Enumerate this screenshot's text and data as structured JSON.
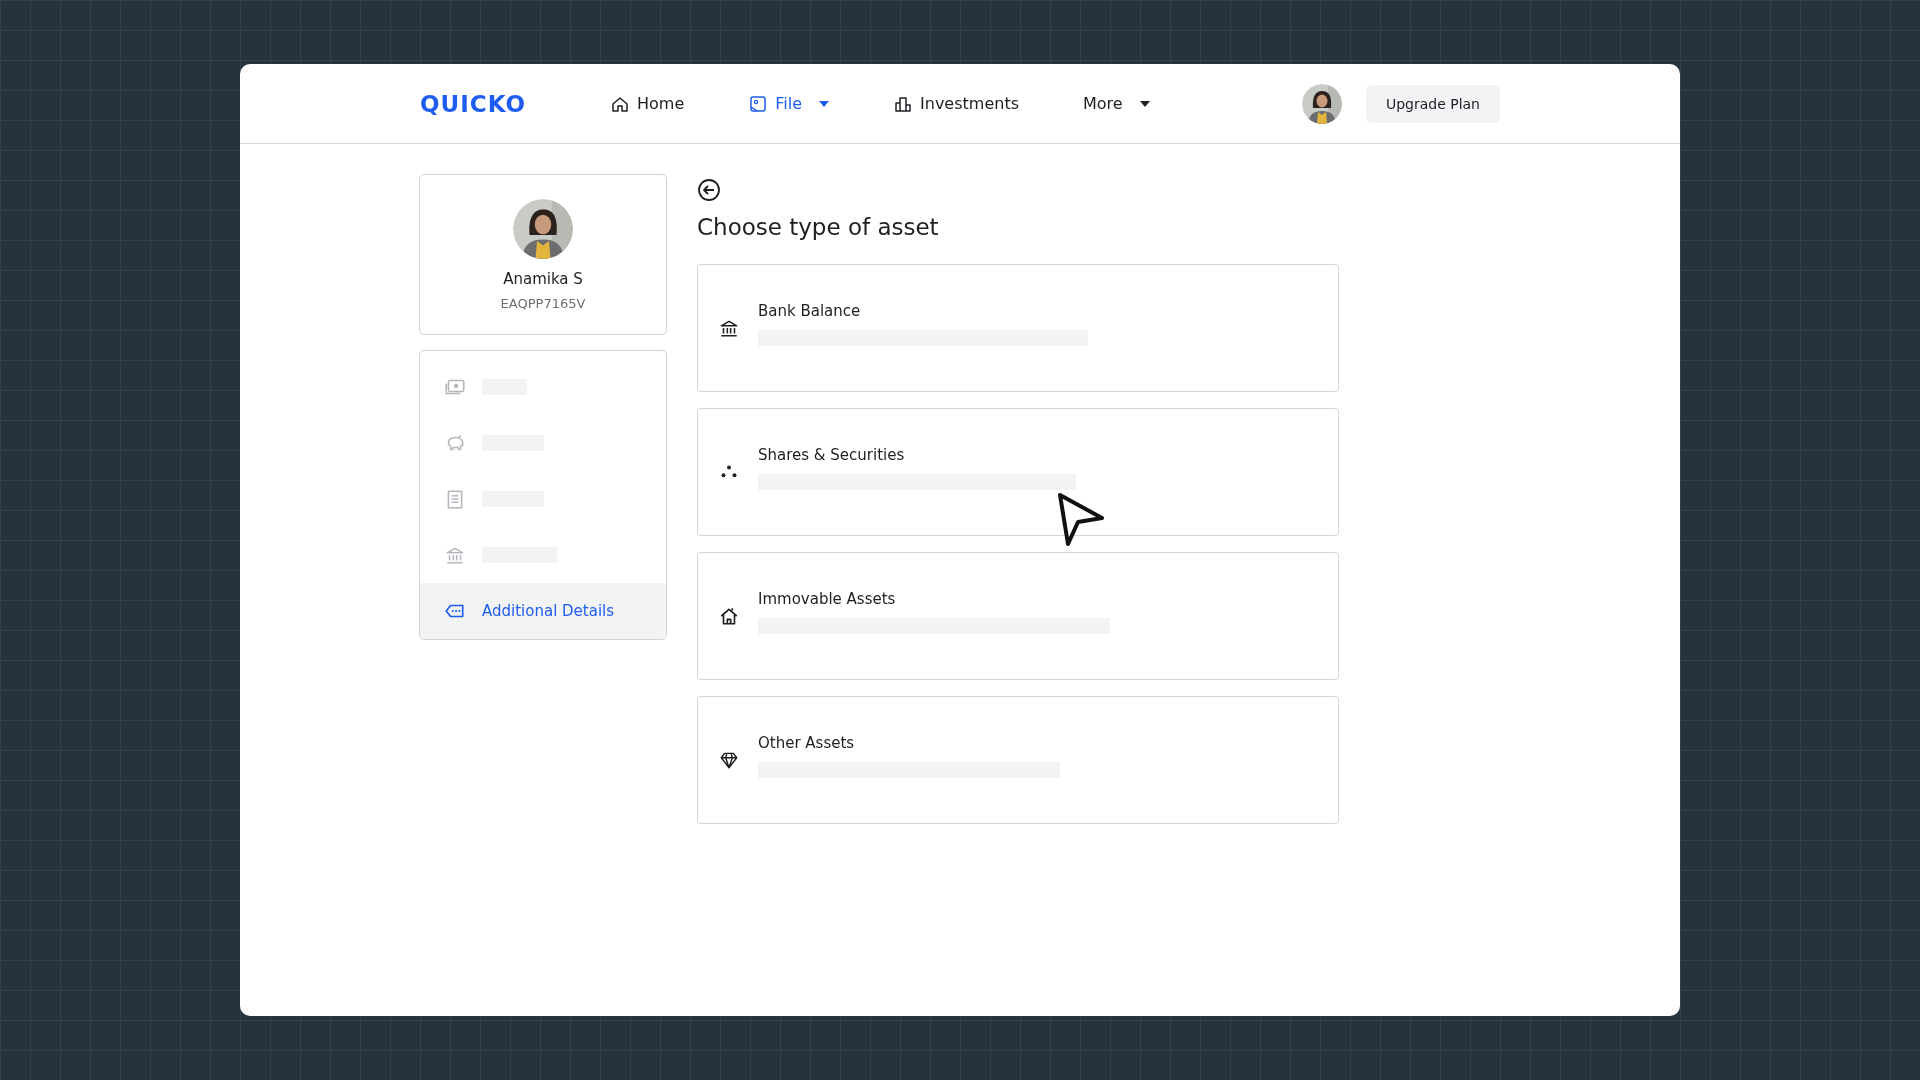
{
  "header": {
    "logo": "QUICKO",
    "nav": [
      {
        "label": "Home",
        "selected": false,
        "dropdown": false
      },
      {
        "label": "File",
        "selected": true,
        "dropdown": true
      },
      {
        "label": "Investments",
        "selected": false,
        "dropdown": false
      },
      {
        "label": "More",
        "selected": false,
        "dropdown": true
      }
    ],
    "upgrade_button": "Upgrade Plan"
  },
  "profile": {
    "name": "Anamika S",
    "pan": "EAQPP7165V"
  },
  "sidebar": {
    "items": [
      {
        "kind": "skeleton",
        "selected": false
      },
      {
        "kind": "skeleton",
        "selected": false
      },
      {
        "kind": "skeleton",
        "selected": false
      },
      {
        "kind": "skeleton",
        "selected": false
      },
      {
        "kind": "link",
        "label": "Additional Details",
        "selected": true
      }
    ]
  },
  "main": {
    "title": "Choose type of asset",
    "options": [
      {
        "label": "Bank Balance"
      },
      {
        "label": "Shares & Securities"
      },
      {
        "label": "Immovable Assets"
      },
      {
        "label": "Other Assets"
      }
    ]
  }
}
